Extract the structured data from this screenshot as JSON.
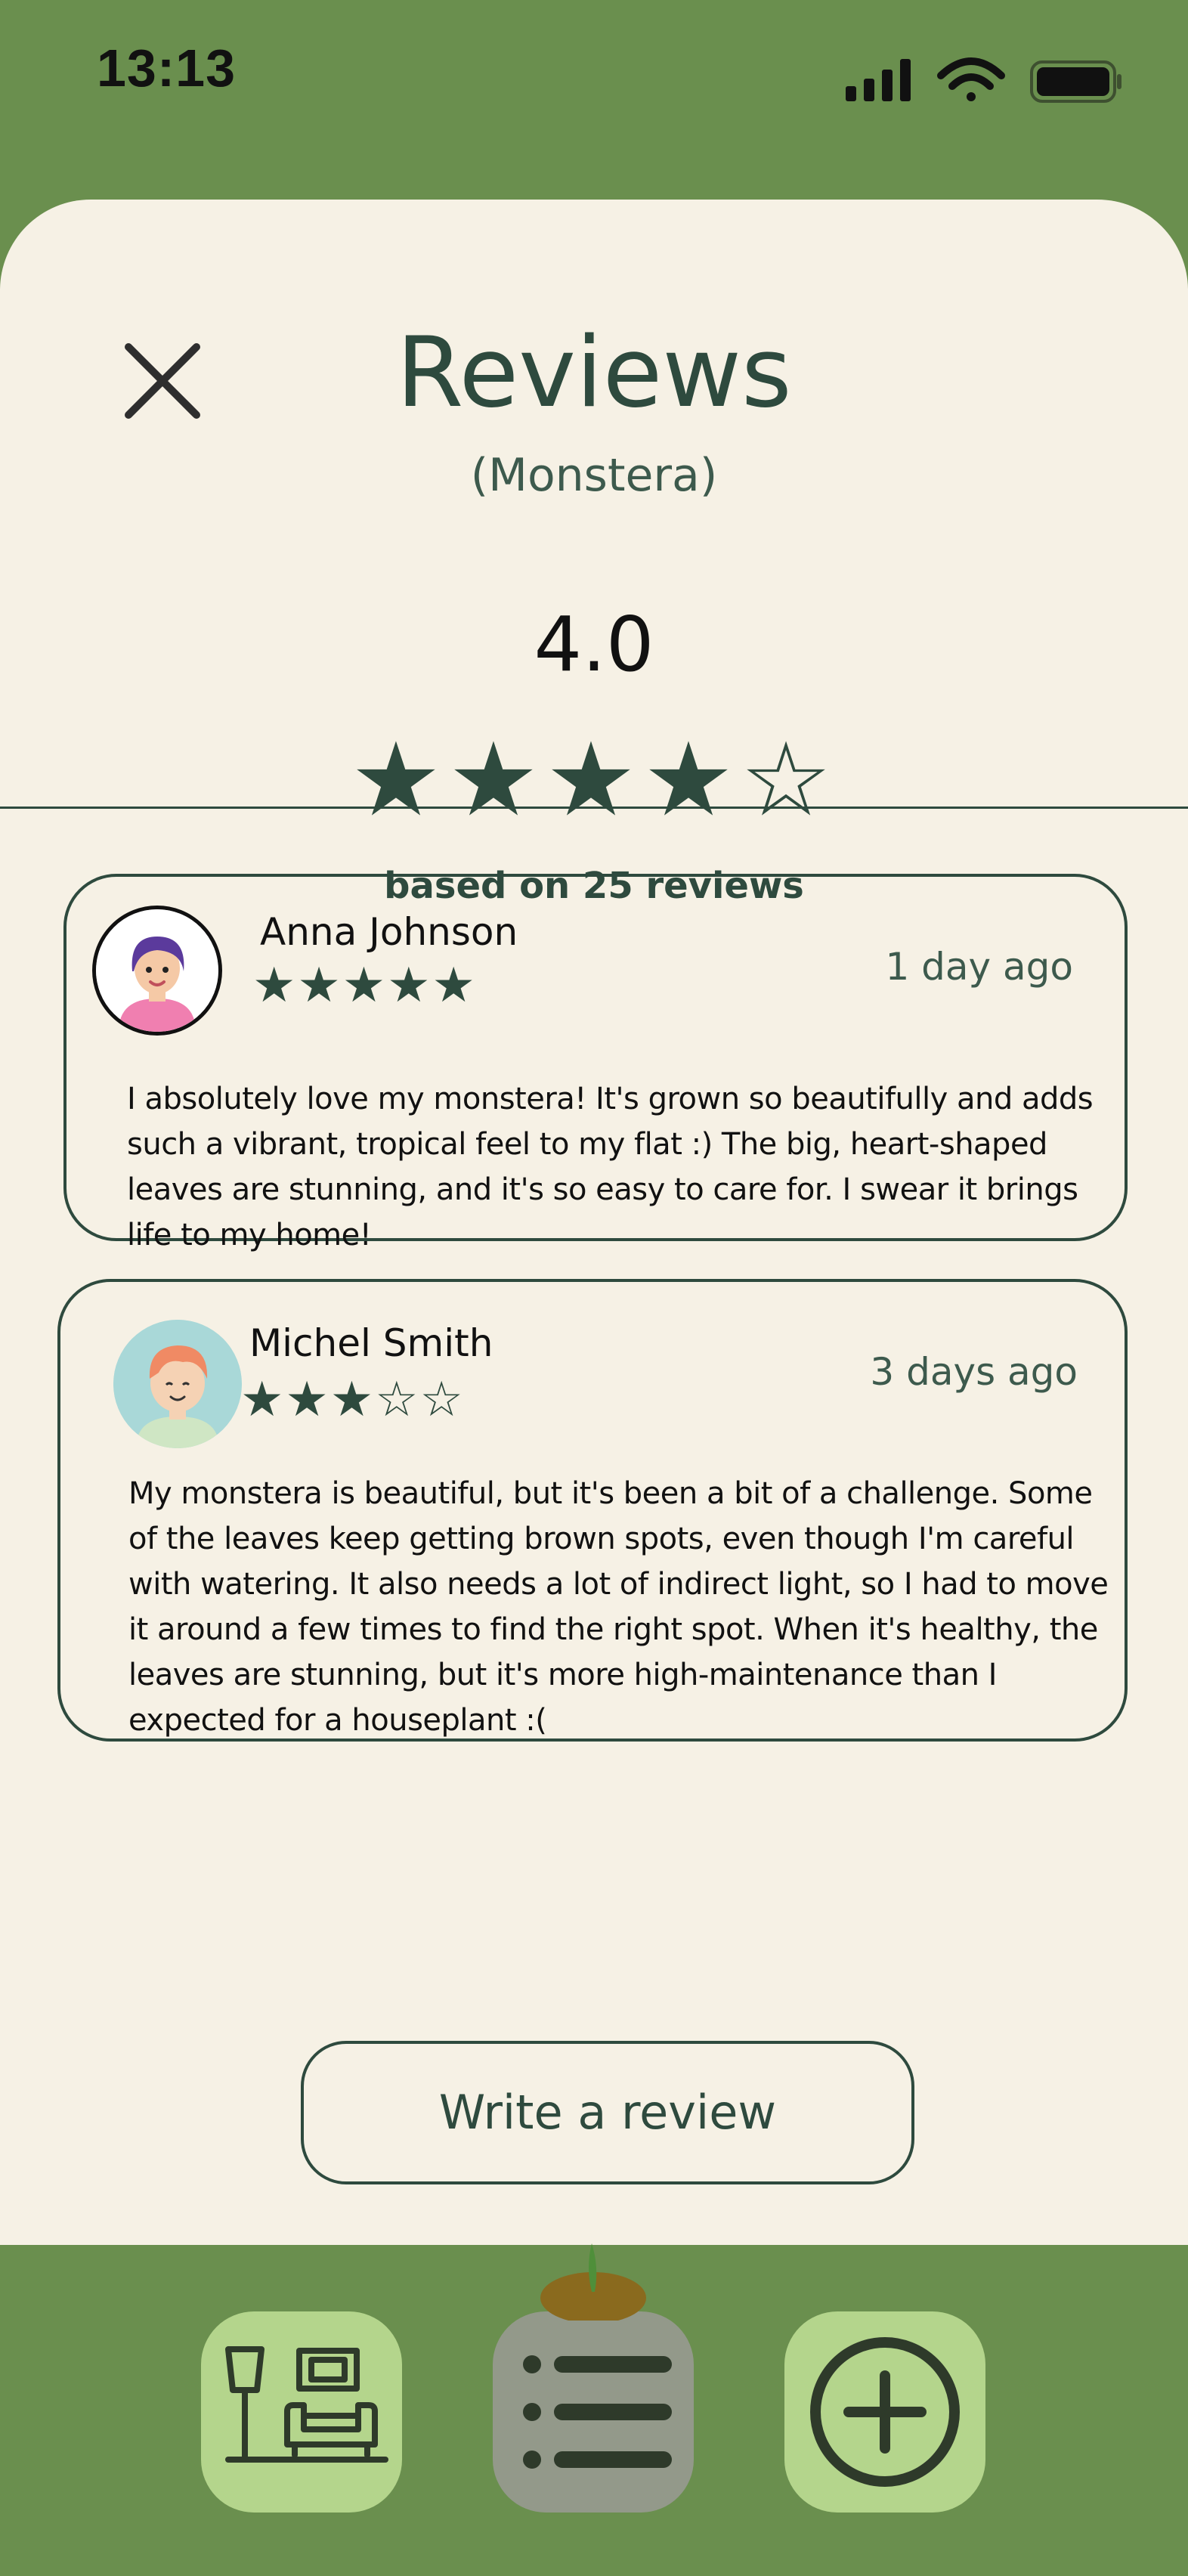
{
  "status_bar": {
    "time": "13:13",
    "icons": [
      "cellular-signal-icon",
      "wifi-icon",
      "battery-icon"
    ]
  },
  "header": {
    "title": "Reviews",
    "subtitle": "(Monstera)",
    "close_icon": "close-icon"
  },
  "summary": {
    "rating": "4.0",
    "stars": "★★★★☆",
    "stars_filled": 4,
    "stars_total": 5,
    "count_text": "based on 25 reviews"
  },
  "reviews": [
    {
      "name": "Anna Johnson",
      "stars": "★★★★★",
      "rating": 5,
      "time": "1 day ago",
      "text": "I absolutely love my monstera! It's grown so beautifully and adds such a vibrant, tropical feel to my flat :) The big, heart-shaped leaves are stunning, and it's so easy to care for. I swear it brings life to my home!"
    },
    {
      "name": "Michel Smith",
      "stars": "★★★☆☆",
      "rating": 3,
      "time": "3 days ago",
      "text": "My monstera is beautiful, but it's been a bit of a challenge. Some of the leaves keep getting brown spots, even though I'm careful with watering. It also needs a lot of indirect light, so I had to move it around a few times to find the right spot. When it's healthy, the leaves are stunning, but it's more high-maintenance than I expected for a houseplant :("
    }
  ],
  "write_review_label": "Write a review",
  "tab_bar": {
    "tabs": [
      {
        "name": "home",
        "icon": "living-room-icon",
        "active": false
      },
      {
        "name": "list",
        "icon": "list-icon",
        "active": true
      },
      {
        "name": "add",
        "icon": "plus-circle-icon",
        "active": false
      }
    ]
  },
  "colors": {
    "primary_green": "#6a8f4e",
    "dark_green": "#2e4a3e",
    "background": "#f6f1e5",
    "tab_light": "#b4d58c",
    "tab_active": "#93998a"
  }
}
